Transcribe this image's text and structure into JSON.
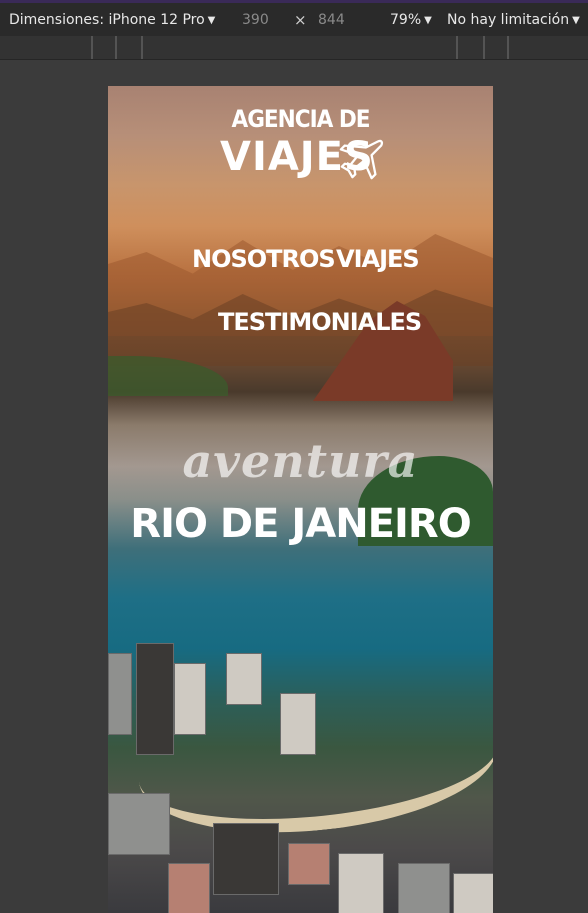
{
  "devtools": {
    "dimensions_label": "Dimensiones: iPhone 12 Pro",
    "width": "390",
    "times": "×",
    "height": "844",
    "zoom": "79%",
    "throttle": "No hay limitación"
  },
  "site": {
    "logo_line1": "AGENCIA DE",
    "logo_line2": "VIAJES",
    "nav": [
      "NOSOTROS",
      "VIAJES",
      "TESTIMONIALES"
    ],
    "hero_subtitle": "aventura",
    "hero_title": "RIO DE JANEIRO"
  },
  "icons": {
    "logo_icon": "airplane-icon",
    "dropdown_icon": "caret-down-icon"
  }
}
